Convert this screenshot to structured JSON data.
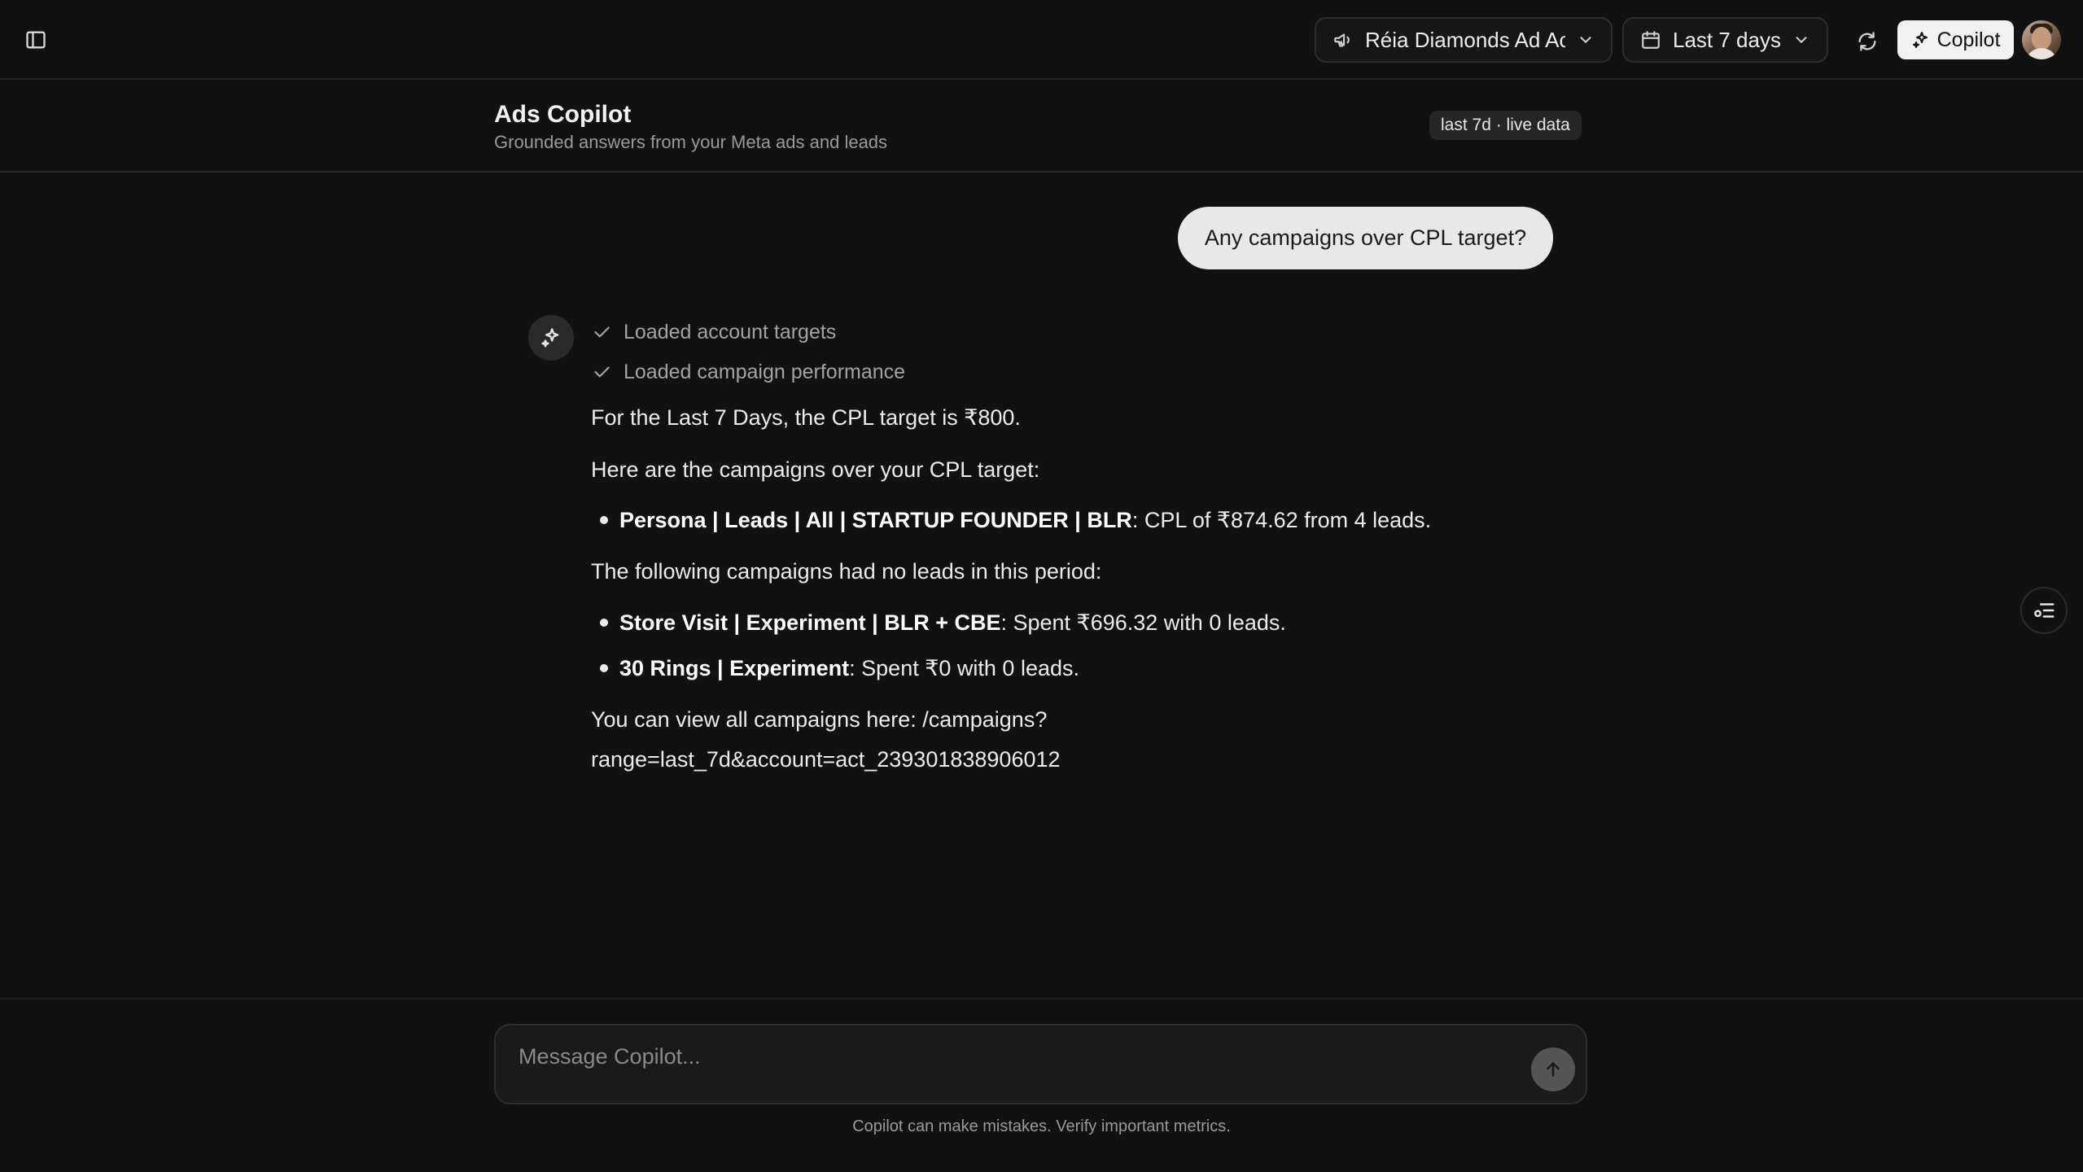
{
  "topbar": {
    "account_select": "Réia Diamonds Ad Ac",
    "range_select": "Last 7 days",
    "copilot_label": "Copilot"
  },
  "header": {
    "title": "Ads Copilot",
    "subtitle": "Grounded answers from your Meta ads and leads",
    "badge": "last 7d · live data"
  },
  "chat": {
    "user_message": "Any campaigns over CPL target?",
    "steps": [
      "Loaded account targets",
      "Loaded campaign performance"
    ],
    "answer": {
      "p1": "For the Last 7 Days, the CPL target is ₹800.",
      "p2": "Here are the campaigns over your CPL target:",
      "over_target": [
        {
          "name": "Persona | Leads | All | STARTUP FOUNDER | BLR",
          "detail": ": CPL of ₹874.62 from 4 leads."
        }
      ],
      "p3": "The following campaigns had no leads in this period:",
      "no_leads": [
        {
          "name": "Store Visit | Experiment | BLR + CBE",
          "detail": ": Spent ₹696.32 with 0 leads."
        },
        {
          "name": "30 Rings | Experiment",
          "detail": ": Spent ₹0 with 0 leads."
        }
      ],
      "p4_line1": "You can view all campaigns here: /campaigns?",
      "p4_line2": "range=last_7d&account=act_239301838906012"
    }
  },
  "composer": {
    "placeholder": "Message Copilot...",
    "disclaimer": "Copilot can make mistakes. Verify important metrics."
  },
  "icons": {
    "sidebar": "sidebar-toggle-icon",
    "megaphone": "megaphone-icon",
    "calendar": "calendar-icon",
    "chevron": "chevron-down-icon",
    "refresh": "refresh-icon",
    "sparkle": "sparkle-icon",
    "check": "check-icon",
    "send": "arrow-up-icon",
    "list": "list-settings-icon"
  }
}
